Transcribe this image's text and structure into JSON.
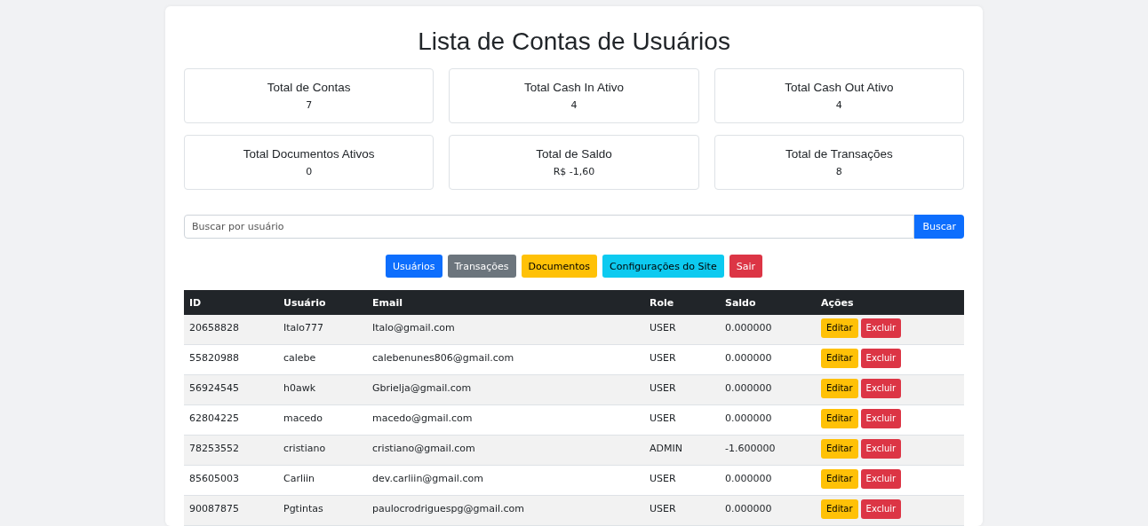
{
  "title": "Lista de Contas de Usuários",
  "stats": [
    {
      "label": "Total de Contas",
      "value": "7"
    },
    {
      "label": "Total Cash In Ativo",
      "value": "4"
    },
    {
      "label": "Total Cash Out Ativo",
      "value": "4"
    },
    {
      "label": "Total Documentos Ativos",
      "value": "0"
    },
    {
      "label": "Total de Saldo",
      "value": "R$ -1,60"
    },
    {
      "label": "Total de Transações",
      "value": "8"
    }
  ],
  "search": {
    "placeholder": "Buscar por usuário",
    "button": "Buscar"
  },
  "nav": [
    {
      "label": "Usuários",
      "kind": "primary"
    },
    {
      "label": "Transações",
      "kind": "secondary"
    },
    {
      "label": "Documentos",
      "kind": "warning"
    },
    {
      "label": "Configurações do Site",
      "kind": "info"
    },
    {
      "label": "Sair",
      "kind": "danger"
    }
  ],
  "table": {
    "columns": [
      "ID",
      "Usuário",
      "Email",
      "Role",
      "Saldo",
      "Ações"
    ],
    "rows": [
      {
        "cells": [
          "20658828",
          "Italo777",
          "Italo@gmail.com",
          "USER",
          "0.000000"
        ],
        "actions": [
          "Editar",
          "Excluir"
        ]
      },
      {
        "cells": [
          "55820988",
          "calebe",
          "calebenunes806@gmail.com",
          "USER",
          "0.000000"
        ],
        "actions": [
          "Editar",
          "Excluir"
        ]
      },
      {
        "cells": [
          "56924545",
          "h0awk",
          "Gbrielja@gmail.com",
          "USER",
          "0.000000"
        ],
        "actions": [
          "Editar",
          "Excluir"
        ]
      },
      {
        "cells": [
          "62804225",
          "macedo",
          "macedo@gmail.com",
          "USER",
          "0.000000"
        ],
        "actions": [
          "Editar",
          "Excluir"
        ]
      },
      {
        "cells": [
          "78253552",
          "cristiano",
          "cristiano@gmail.com",
          "ADMIN",
          "-1.600000"
        ],
        "actions": [
          "Editar",
          "Excluir"
        ]
      },
      {
        "cells": [
          "85605003",
          "Carliin",
          "dev.carliin@gmail.com",
          "USER",
          "0.000000"
        ],
        "actions": [
          "Editar",
          "Excluir"
        ]
      },
      {
        "cells": [
          "90087875",
          "Pgtintas",
          "paulocrodriguespg@gmail.com",
          "USER",
          "0.000000"
        ],
        "actions": [
          "Editar",
          "Excluir"
        ]
      }
    ]
  }
}
